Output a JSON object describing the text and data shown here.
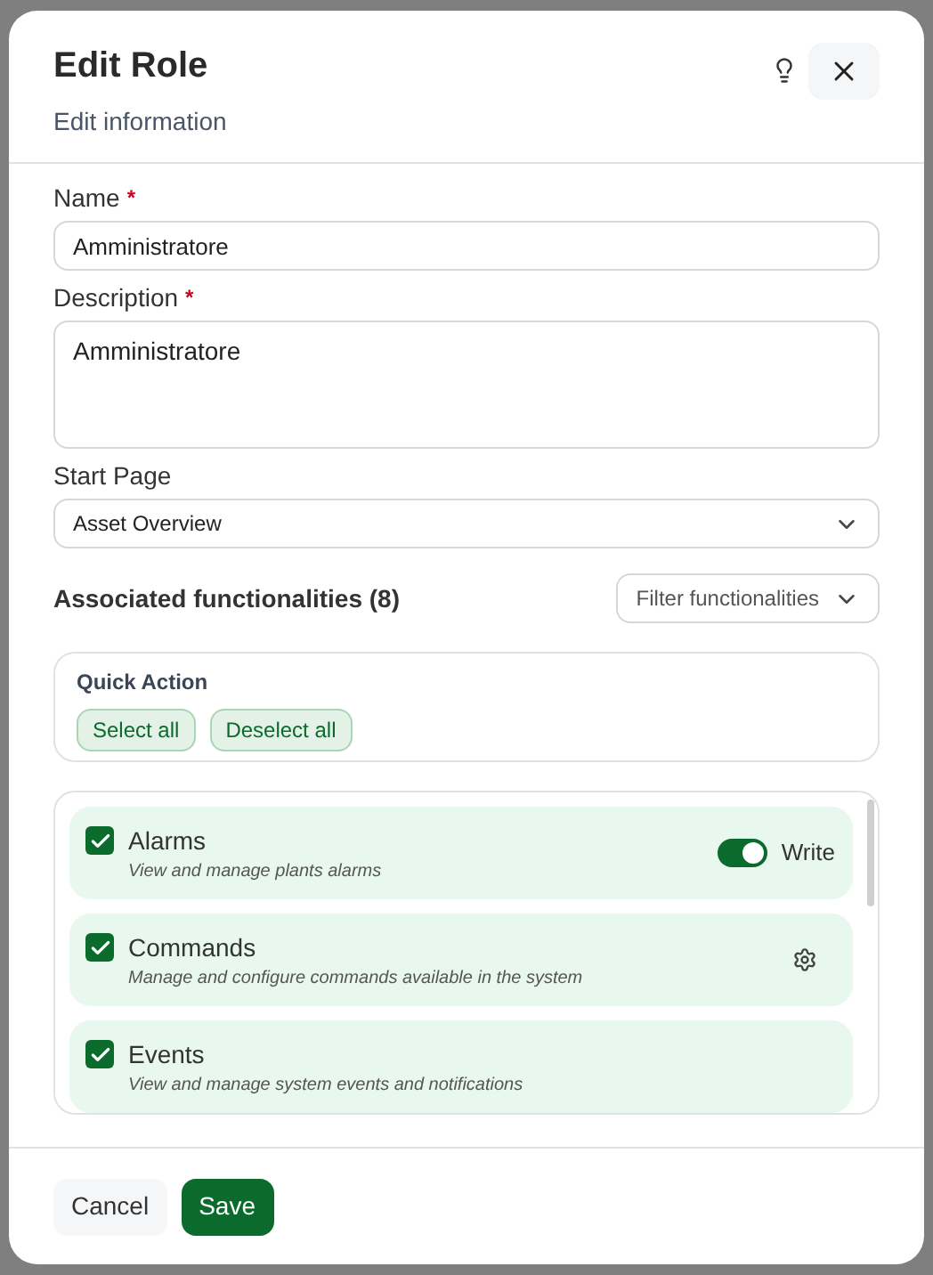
{
  "dialog": {
    "title": "Edit Role",
    "subtitle": "Edit information"
  },
  "fields": [
    {
      "kind": "input",
      "label": "Name",
      "required_mark": "*",
      "value": "Amministratore"
    },
    {
      "kind": "textarea",
      "label": "Description",
      "required_mark": "*",
      "value": "Amministratore"
    },
    {
      "kind": "select",
      "label": "Start Page",
      "value": "Asset Overview"
    }
  ],
  "functionalities_heading": "Associated functionalities (8)",
  "filter": {
    "placeholder": "Filter functionalities"
  },
  "quick_action": {
    "title": "Quick Action",
    "buttons": [
      "Select all",
      "Deselect all"
    ]
  },
  "functionalities": [
    {
      "name": "Alarms",
      "description": "View and manage plants alarms",
      "checked": true,
      "kind": "toggle",
      "toggle_label": "Write",
      "on": true
    },
    {
      "name": "Commands",
      "description": "Manage and configure commands available in the system",
      "checked": true,
      "kind": "settings"
    },
    {
      "name": "Events",
      "description": "View and manage system events and notifications",
      "checked": true,
      "kind": "plain"
    }
  ],
  "footer_buttons": [
    {
      "label": "Cancel",
      "kind": "secondary"
    },
    {
      "label": "Save",
      "kind": "primary"
    }
  ]
}
